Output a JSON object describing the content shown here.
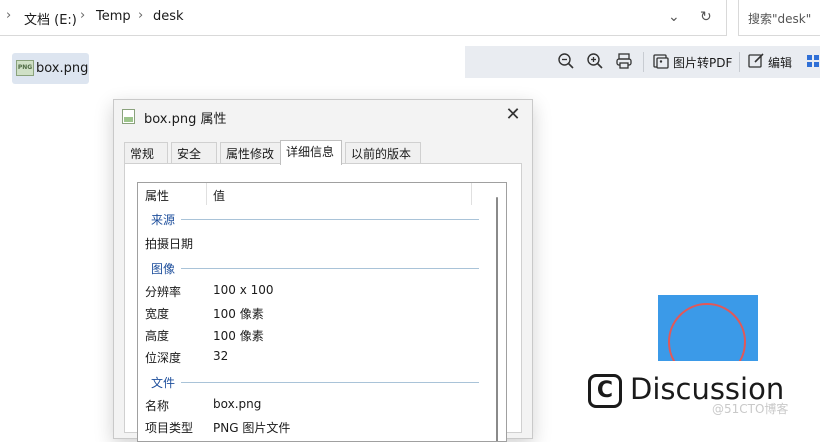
{
  "address_bar": {
    "breadcrumbs": [
      "文档 (E:)",
      "Temp",
      "desk"
    ],
    "search_placeholder": "搜索\"desk\""
  },
  "file_item": {
    "name": "box.png",
    "icon_text": "PNG"
  },
  "preview_toolbar": {
    "zoom_out_icon": "zoom-out-icon",
    "zoom_in_icon": "zoom-in-icon",
    "print_icon": "print-icon",
    "convert_pdf_label": "图片转PDF",
    "edit_label": "编辑"
  },
  "dialog": {
    "title": "box.png 属性",
    "tabs": [
      "常规",
      "安全",
      "属性修改",
      "详细信息",
      "以前的版本"
    ],
    "active_tab": "详细信息",
    "columns": {
      "name": "属性",
      "value": "值"
    },
    "groups": {
      "source": {
        "label": "来源",
        "rows": [
          {
            "name": "拍摄日期",
            "value": ""
          }
        ]
      },
      "image": {
        "label": "图像",
        "rows": [
          {
            "name": "分辨率",
            "value": "100 x 100"
          },
          {
            "name": "宽度",
            "value": "100 像素"
          },
          {
            "name": "高度",
            "value": "100 像素"
          },
          {
            "name": "位深度",
            "value": "32"
          }
        ]
      },
      "file": {
        "label": "文件",
        "rows": [
          {
            "name": "名称",
            "value": "box.png"
          },
          {
            "name": "项目类型",
            "value": "PNG 图片文件"
          }
        ]
      }
    }
  },
  "overlay": {
    "discussion_text": "Discussion",
    "discussion_logo": "C",
    "watermark": "@51CTO博客"
  },
  "colors": {
    "preview_image_bg": "#3b9ae8",
    "circle_stroke": "#e25858",
    "group_label": "#1e4f9c"
  }
}
